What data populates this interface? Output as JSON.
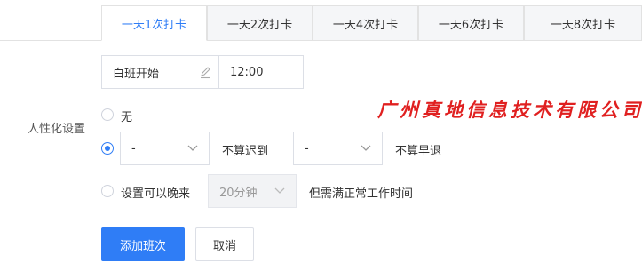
{
  "tabs": [
    {
      "label": "一天1次打卡",
      "active": true
    },
    {
      "label": "一天2次打卡",
      "active": false
    },
    {
      "label": "一天4次打卡",
      "active": false
    },
    {
      "label": "一天6次打卡",
      "active": false
    },
    {
      "label": "一天8次打卡",
      "active": false
    }
  ],
  "shift": {
    "name": "白班开始",
    "time": "12:00",
    "edit_icon": "pencil-icon"
  },
  "watermark_text": "广州真地信息技术有限公司",
  "humanize": {
    "label": "人性化设置",
    "options": {
      "none": {
        "label": "无",
        "checked": false
      },
      "late_early": {
        "checked": true,
        "late_value": "-",
        "late_suffix": "不算迟到",
        "early_value": "-",
        "early_suffix": "不算早退"
      },
      "late_arrival": {
        "checked": false,
        "label": "设置可以晚来",
        "value": "20分钟",
        "suffix": "但需满正常工作时间"
      }
    }
  },
  "actions": {
    "add_label": "添加班次",
    "cancel_label": "取消"
  },
  "colors": {
    "accent": "#2f7df6",
    "watermark": "#e02020",
    "border": "#dcdfe6"
  }
}
